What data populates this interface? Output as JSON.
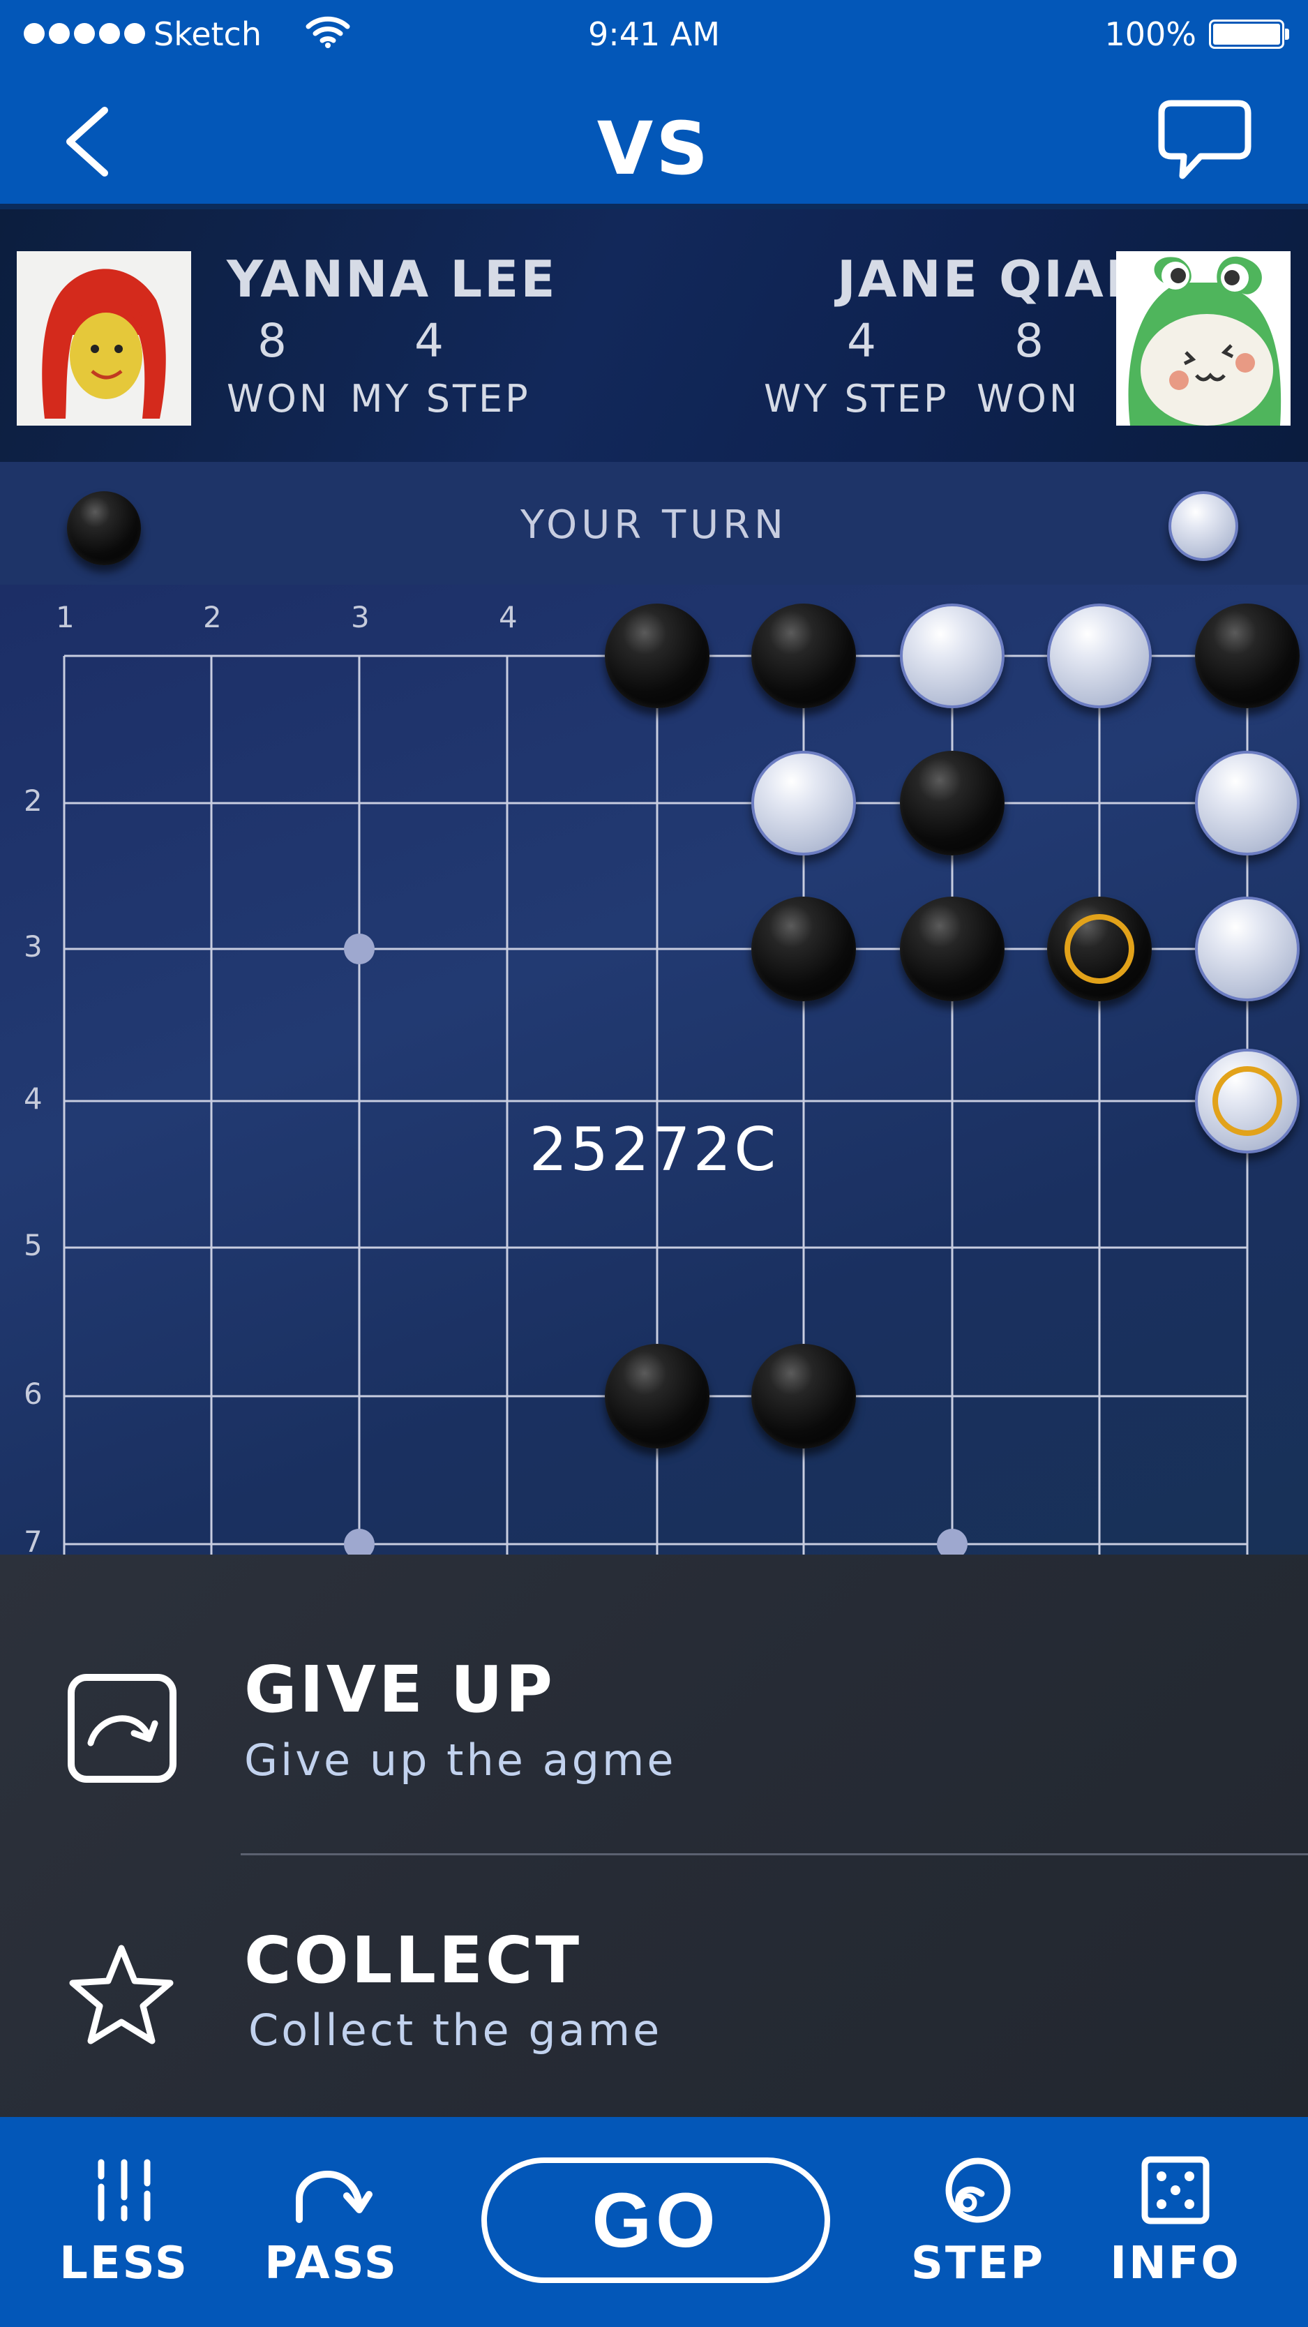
{
  "status_bar": {
    "carrier": "Sketch",
    "time": "9:41 AM",
    "battery": "100%"
  },
  "nav": {
    "title": "VS",
    "back_icon": "chevron-left-icon",
    "chat_icon": "chat-bubble-icon"
  },
  "player_left": {
    "name": "YANNA LEE",
    "won_value": "8",
    "step_value": "4",
    "won_label": "WON",
    "step_label": "MY STEP"
  },
  "player_right": {
    "name": "JANE QIAN",
    "step_value": "4",
    "won_value": "8",
    "step_label": "WY STEP",
    "won_label": "WON"
  },
  "turn": {
    "text": "YOUR TURN"
  },
  "board": {
    "col_labels": [
      "1",
      "2",
      "3",
      "4"
    ],
    "row_labels": [
      "2",
      "3",
      "4",
      "5",
      "6",
      "7"
    ],
    "center_text": "25272C",
    "stones": [
      {
        "color": "black",
        "col": 5,
        "row": 1
      },
      {
        "color": "black",
        "col": 6,
        "row": 1
      },
      {
        "color": "white",
        "col": 7,
        "row": 1
      },
      {
        "color": "white",
        "col": 8,
        "row": 1
      },
      {
        "color": "black",
        "col": 9,
        "row": 1
      },
      {
        "color": "white",
        "col": 6,
        "row": 2
      },
      {
        "color": "black",
        "col": 7,
        "row": 2
      },
      {
        "color": "white",
        "col": 9,
        "row": 2
      },
      {
        "color": "black",
        "col": 6,
        "row": 3
      },
      {
        "color": "black",
        "col": 7,
        "row": 3
      },
      {
        "color": "black",
        "col": 8,
        "row": 3,
        "marked": true
      },
      {
        "color": "white",
        "col": 9,
        "row": 3
      },
      {
        "color": "white",
        "col": 9,
        "row": 4,
        "marked": true
      },
      {
        "color": "black",
        "col": 5,
        "row": 6
      },
      {
        "color": "black",
        "col": 6,
        "row": 6
      }
    ],
    "star_points": [
      {
        "col": 3,
        "row": 3
      },
      {
        "col": 3,
        "row": 7
      },
      {
        "col": 7,
        "row": 7
      }
    ]
  },
  "menu": {
    "give_up_title": "GIVE UP",
    "give_up_subtitle": "Give up the agme",
    "give_up_icon": "give-up-icon",
    "collect_title": "COLLECT",
    "collect_subtitle": "Collect the game",
    "collect_icon": "star-icon"
  },
  "tabbar": {
    "less_label": "LESS",
    "pass_label": "PASS",
    "go_label": "GO",
    "step_label": "STEP",
    "info_label": "INFO"
  },
  "colors": {
    "brand_blue": "#0357b8",
    "marker_gold": "#e2a21a"
  }
}
